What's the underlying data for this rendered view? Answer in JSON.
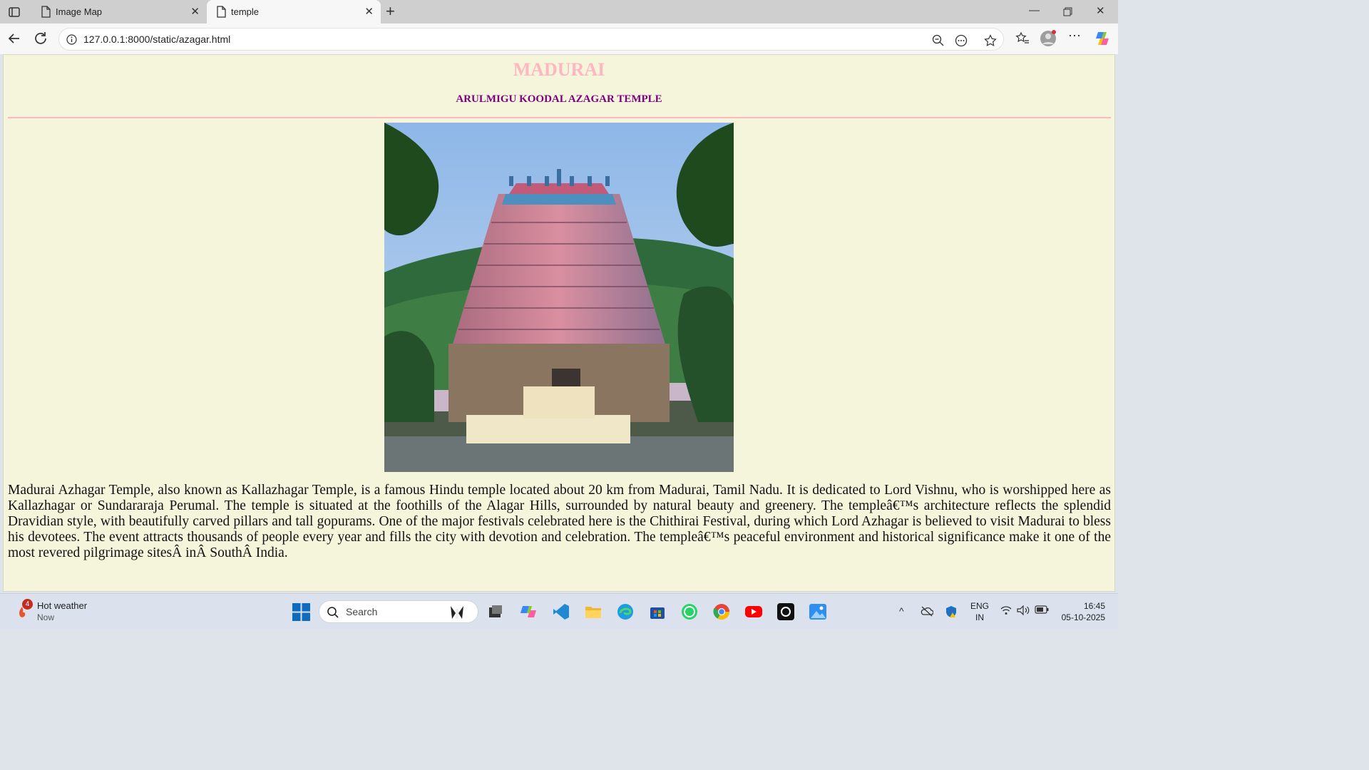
{
  "browser": {
    "tabs": [
      {
        "label": "Image Map"
      },
      {
        "label": "temple"
      }
    ],
    "url": "127.0.0.1:8000/static/azagar.html"
  },
  "page": {
    "title": "MADURAI",
    "subtitle": "ARULMIGU KOODAL AZAGAR TEMPLE",
    "paragraph": "Madurai Azhagar Temple, also known as Kallazhagar Temple, is a famous Hindu temple located about 20 km from Madurai, Tamil Nadu. It is dedicated to Lord Vishnu, who is worshipped here as Kallazhagar or Sundararaja Perumal. The temple is situated at the foothills of the Alagar Hills, surrounded by natural beauty and greenery. The templeâ€™s architecture reflects the splendid Dravidian style, with beautifully carved pillars and tall gopurams. One of the major festivals celebrated here is the Chithirai Festival, during which Lord Azhagar is believed to visit Madurai to bless his devotees. The event attracts thousands of people every year and fills the city with devotion and celebration. The templeâ€™s peaceful environment and historical significance make it one of the most revered pilgrimage sitesÂ inÂ SouthÂ India."
  },
  "taskbar": {
    "weather": {
      "badge": "4",
      "title": "Hot weather",
      "subtitle": "Now"
    },
    "search_label": "Search",
    "language": {
      "line1": "ENG",
      "line2": "IN"
    },
    "clock": {
      "time": "16:45",
      "date": "05-10-2025"
    }
  },
  "colors": {
    "page_background": "#f5f5dc",
    "title": "#ffb6c1",
    "subtitle": "#800080",
    "rule": "#ffb6c1"
  }
}
